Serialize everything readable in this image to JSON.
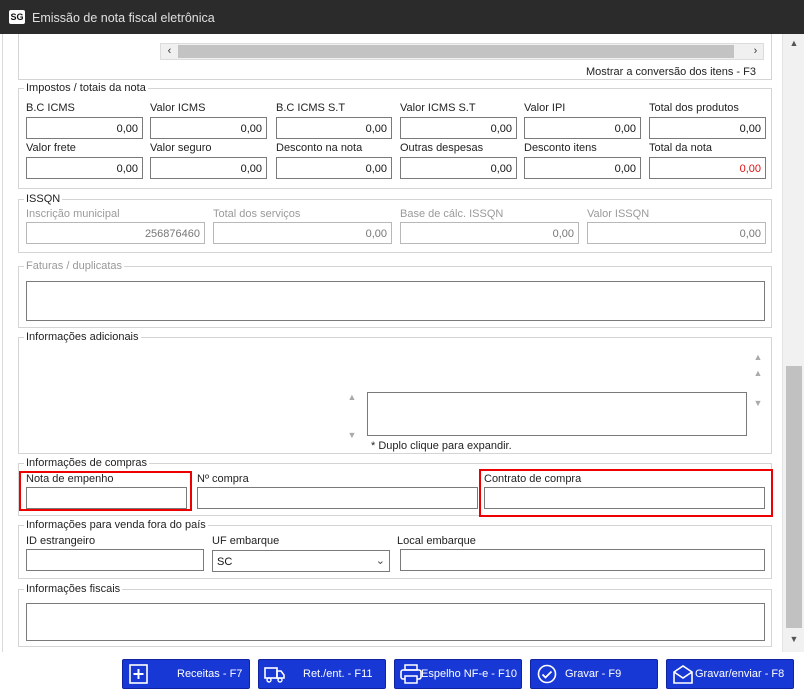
{
  "window": {
    "logo": "SG",
    "title": "Emissão de nota fiscal eletrônica"
  },
  "items": {
    "conversion_link": "Mostrar a conversão dos itens - F3"
  },
  "impostos": {
    "legend": "Impostos / totais da nota",
    "row1": [
      {
        "label": "B.C ICMS",
        "value": "0,00"
      },
      {
        "label": "Valor ICMS",
        "value": "0,00"
      },
      {
        "label": "B.C ICMS S.T",
        "value": "0,00"
      },
      {
        "label": "Valor ICMS S.T",
        "value": "0,00"
      },
      {
        "label": "Valor IPI",
        "value": "0,00"
      },
      {
        "label": "Total dos produtos",
        "value": "0,00"
      }
    ],
    "row2": [
      {
        "label": "Valor frete",
        "value": "0,00"
      },
      {
        "label": "Valor seguro",
        "value": "0,00"
      },
      {
        "label": "Desconto na nota",
        "value": "0,00"
      },
      {
        "label": "Outras despesas",
        "value": "0,00"
      },
      {
        "label": "Desconto itens",
        "value": "0,00"
      },
      {
        "label": "Total da nota",
        "value": "0,00"
      }
    ]
  },
  "issqn": {
    "legend": "ISSQN",
    "fields": [
      {
        "label": "Inscrição municipal",
        "value": "256876460"
      },
      {
        "label": "Total dos serviços",
        "value": "0,00"
      },
      {
        "label": "Base de cálc. ISSQN",
        "value": "0,00"
      },
      {
        "label": "Valor ISSQN",
        "value": "0,00"
      }
    ]
  },
  "faturas": {
    "legend": "Faturas / duplicatas"
  },
  "adicionais": {
    "legend": "Informações adicionais",
    "hint": "* Duplo clique para expandir."
  },
  "compras": {
    "legend": "Informações de compras",
    "nota_empenho": {
      "label": "Nota de empenho",
      "value": ""
    },
    "numero_compra": {
      "label": "Nº compra",
      "value": ""
    },
    "contrato": {
      "label": "Contrato de compra",
      "value": ""
    }
  },
  "exterior": {
    "legend": "Informações para venda fora do país",
    "id_estrangeiro": {
      "label": "ID estrangeiro",
      "value": ""
    },
    "uf_embarque": {
      "label": "UF embarque",
      "value": "SC"
    },
    "local_embarque": {
      "label": "Local embarque",
      "value": ""
    }
  },
  "fiscais": {
    "legend": "Informações fiscais"
  },
  "buttons": {
    "receitas": "Receitas - F7",
    "ret_ent": "Ret./ent. - F11",
    "espelho": "Espelho NF-e - F10",
    "gravar": "Gravar - F9",
    "gravar_enviar": "Gravar/enviar - F8"
  },
  "colors": {
    "button": "#1838d6",
    "highlight": "#e00000",
    "total_nota": "#dd1111"
  }
}
